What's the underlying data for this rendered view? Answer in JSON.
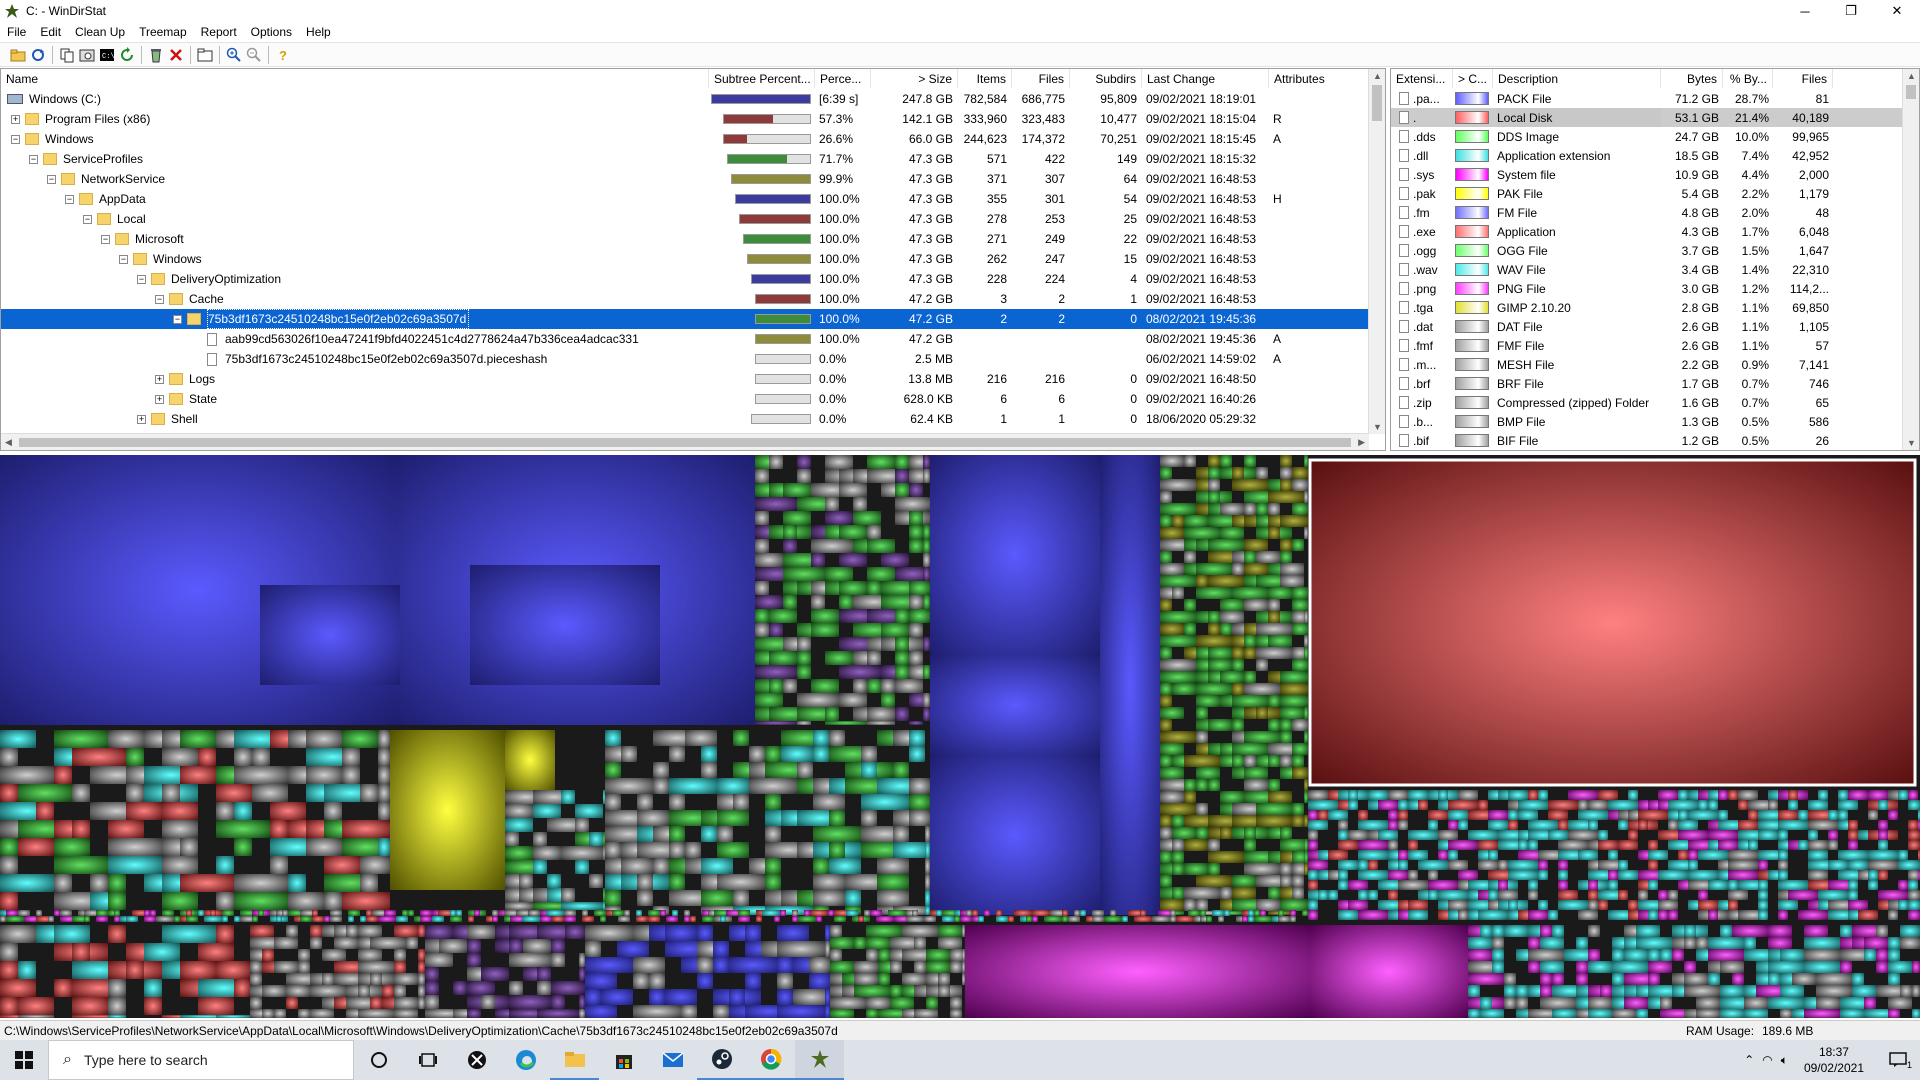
{
  "window": {
    "title": "C: - WinDirStat",
    "minimize": "─",
    "maximize": "❐",
    "close": "✕"
  },
  "menu": [
    "File",
    "Edit",
    "Clean Up",
    "Treemap",
    "Report",
    "Options",
    "Help"
  ],
  "toolbar": {
    "icons": [
      "open-icon",
      "refresh-all-icon",
      "copy-path-icon",
      "explorer-icon",
      "command-prompt-icon",
      "refresh-selected-icon",
      "recycle-icon",
      "delete-icon",
      "properties-icon",
      "zoom-in-icon",
      "zoom-out-icon",
      "help-icon"
    ]
  },
  "tree": {
    "headers": {
      "name": "Name",
      "subtree": "Subtree Percent...",
      "perc": "Perce...",
      "size": "> Size",
      "items": "Items",
      "files": "Files",
      "subdirs": "Subdirs",
      "lastchange": "Last Change",
      "attributes": "Attributes"
    },
    "rows": [
      {
        "indent": 0,
        "pm": "",
        "icon": "drive",
        "name": "Windows (C:)",
        "bar": 1.0,
        "barColor": "#3c3ca0",
        "perc": "[6:39 s]",
        "size": "247.8 GB",
        "items": "782,584",
        "files": "686,775",
        "subdirs": "95,809",
        "last": "09/02/2021  18:19:01",
        "attr": ""
      },
      {
        "indent": 0,
        "pm": "+",
        "icon": "folder",
        "name": "Program Files (x86)",
        "bar": 0.573,
        "barColor": "#8c3a3a",
        "perc": "57.3%",
        "size": "142.1 GB",
        "items": "333,960",
        "files": "323,483",
        "subdirs": "10,477",
        "last": "09/02/2021  18:15:04",
        "attr": "R"
      },
      {
        "indent": 0,
        "pm": "−",
        "icon": "folder",
        "name": "Windows",
        "bar": 0.266,
        "barColor": "#8c3a3a",
        "perc": "26.6%",
        "size": "66.0 GB",
        "items": "244,623",
        "files": "174,372",
        "subdirs": "70,251",
        "last": "09/02/2021  18:15:45",
        "attr": "A"
      },
      {
        "indent": 1,
        "pm": "−",
        "icon": "folder",
        "name": "ServiceProfiles",
        "bar": 0.717,
        "barColor": "#3c8c3c",
        "perc": "71.7%",
        "size": "47.3 GB",
        "items": "571",
        "files": "422",
        "subdirs": "149",
        "last": "09/02/2021  18:15:32",
        "attr": ""
      },
      {
        "indent": 2,
        "pm": "−",
        "icon": "folder",
        "name": "NetworkService",
        "bar": 0.999,
        "barColor": "#8c8c3a",
        "perc": "99.9%",
        "size": "47.3 GB",
        "items": "371",
        "files": "307",
        "subdirs": "64",
        "last": "09/02/2021  16:48:53",
        "attr": ""
      },
      {
        "indent": 3,
        "pm": "−",
        "icon": "folder",
        "name": "AppData",
        "bar": 1.0,
        "barColor": "#3c3ca0",
        "perc": "100.0%",
        "size": "47.3 GB",
        "items": "355",
        "files": "301",
        "subdirs": "54",
        "last": "09/02/2021  16:48:53",
        "attr": "H"
      },
      {
        "indent": 4,
        "pm": "−",
        "icon": "folder",
        "name": "Local",
        "bar": 1.0,
        "barColor": "#8c3a3a",
        "perc": "100.0%",
        "size": "47.3 GB",
        "items": "278",
        "files": "253",
        "subdirs": "25",
        "last": "09/02/2021  16:48:53",
        "attr": ""
      },
      {
        "indent": 5,
        "pm": "−",
        "icon": "folder",
        "name": "Microsoft",
        "bar": 1.0,
        "barColor": "#3c8c3c",
        "perc": "100.0%",
        "size": "47.3 GB",
        "items": "271",
        "files": "249",
        "subdirs": "22",
        "last": "09/02/2021  16:48:53",
        "attr": ""
      },
      {
        "indent": 6,
        "pm": "−",
        "icon": "folder",
        "name": "Windows",
        "bar": 1.0,
        "barColor": "#8c8c3a",
        "perc": "100.0%",
        "size": "47.3 GB",
        "items": "262",
        "files": "247",
        "subdirs": "15",
        "last": "09/02/2021  16:48:53",
        "attr": ""
      },
      {
        "indent": 7,
        "pm": "−",
        "icon": "folder",
        "name": "DeliveryOptimization",
        "bar": 1.0,
        "barColor": "#3c3ca0",
        "perc": "100.0%",
        "size": "47.3 GB",
        "items": "228",
        "files": "224",
        "subdirs": "4",
        "last": "09/02/2021  16:48:53",
        "attr": ""
      },
      {
        "indent": 8,
        "pm": "−",
        "icon": "folder",
        "name": "Cache",
        "bar": 1.0,
        "barColor": "#8c3a3a",
        "perc": "100.0%",
        "size": "47.2 GB",
        "items": "3",
        "files": "2",
        "subdirs": "1",
        "last": "09/02/2021  16:48:53",
        "attr": ""
      },
      {
        "indent": 9,
        "pm": "−",
        "icon": "folder",
        "name": "75b3df1673c24510248bc15e0f2eb02c69a3507d",
        "bar": 1.0,
        "barColor": "#3c8c3c",
        "perc": "100.0%",
        "size": "47.2 GB",
        "items": "2",
        "files": "2",
        "subdirs": "0",
        "last": "08/02/2021  19:45:36",
        "attr": "",
        "selected": true
      },
      {
        "indent": 10,
        "pm": "",
        "icon": "file",
        "name": "aab99cd563026f10ea47241f9bfd4022451c4d2778624a47b336cea4adcac331",
        "bar": 1.0,
        "barColor": "#8c8c3a",
        "perc": "100.0%",
        "size": "47.2 GB",
        "items": "",
        "files": "",
        "subdirs": "",
        "last": "08/02/2021  19:45:36",
        "attr": "A"
      },
      {
        "indent": 10,
        "pm": "",
        "icon": "file",
        "name": "75b3df1673c24510248bc15e0f2eb02c69a3507d.pieceshash",
        "bar": 0.0,
        "barColor": "#8c8c3a",
        "perc": "0.0%",
        "size": "2.5 MB",
        "items": "",
        "files": "",
        "subdirs": "",
        "last": "06/02/2021  14:59:02",
        "attr": "A"
      },
      {
        "indent": 8,
        "pm": "+",
        "icon": "folder",
        "name": "Logs",
        "bar": 0.0,
        "barColor": "#3c3ca0",
        "perc": "0.0%",
        "size": "13.8 MB",
        "items": "216",
        "files": "216",
        "subdirs": "0",
        "last": "09/02/2021  16:48:50",
        "attr": ""
      },
      {
        "indent": 8,
        "pm": "+",
        "icon": "folder",
        "name": "State",
        "bar": 0.0,
        "barColor": "#3c3ca0",
        "perc": "0.0%",
        "size": "628.0 KB",
        "items": "6",
        "files": "6",
        "subdirs": "0",
        "last": "09/02/2021  16:40:26",
        "attr": ""
      },
      {
        "indent": 7,
        "pm": "+",
        "icon": "folder",
        "name": "Shell",
        "bar": 0.0,
        "barColor": "#3c3ca0",
        "perc": "0.0%",
        "size": "62.4 KB",
        "items": "1",
        "files": "1",
        "subdirs": "0",
        "last": "18/06/2020  05:29:32",
        "attr": ""
      }
    ]
  },
  "extensions": {
    "headers": {
      "ext": "Extensi...",
      "color": "> C...",
      "desc": "Description",
      "bytes": "Bytes",
      "pct": "% By...",
      "files": "Files"
    },
    "rows": [
      {
        "ext": ".pa...",
        "color": "#6060ff",
        "desc": "PACK File",
        "bytes": "71.2 GB",
        "pct": "28.7%",
        "files": "81"
      },
      {
        "ext": ".",
        "color": "#ff6060",
        "desc": "Local Disk",
        "bytes": "53.1 GB",
        "pct": "21.4%",
        "files": "40,189",
        "selected": true
      },
      {
        "ext": ".dds",
        "color": "#60ff60",
        "desc": "DDS Image",
        "bytes": "24.7 GB",
        "pct": "10.0%",
        "files": "99,965"
      },
      {
        "ext": ".dll",
        "color": "#40e0e0",
        "desc": "Application extension",
        "bytes": "18.5 GB",
        "pct": "7.4%",
        "files": "42,952"
      },
      {
        "ext": ".sys",
        "color": "#ff00ff",
        "desc": "System file",
        "bytes": "10.9 GB",
        "pct": "4.4%",
        "files": "2,000"
      },
      {
        "ext": ".pak",
        "color": "#ffff00",
        "desc": "PAK File",
        "bytes": "5.4 GB",
        "pct": "2.2%",
        "files": "1,179"
      },
      {
        "ext": ".fm",
        "color": "#7070ff",
        "desc": "FM File",
        "bytes": "4.8 GB",
        "pct": "2.0%",
        "files": "48"
      },
      {
        "ext": ".exe",
        "color": "#ff7070",
        "desc": "Application",
        "bytes": "4.3 GB",
        "pct": "1.7%",
        "files": "6,048"
      },
      {
        "ext": ".ogg",
        "color": "#70ff70",
        "desc": "OGG File",
        "bytes": "3.7 GB",
        "pct": "1.5%",
        "files": "1,647"
      },
      {
        "ext": ".wav",
        "color": "#50e8e8",
        "desc": "WAV File",
        "bytes": "3.4 GB",
        "pct": "1.4%",
        "files": "22,310"
      },
      {
        "ext": ".png",
        "color": "#ff40ff",
        "desc": "PNG File",
        "bytes": "3.0 GB",
        "pct": "1.2%",
        "files": "114,2..."
      },
      {
        "ext": ".tga",
        "color": "#e0e030",
        "desc": "GIMP 2.10.20",
        "bytes": "2.8 GB",
        "pct": "1.1%",
        "files": "69,850"
      },
      {
        "ext": ".dat",
        "color": "#a0a0a0",
        "desc": "DAT File",
        "bytes": "2.6 GB",
        "pct": "1.1%",
        "files": "1,105"
      },
      {
        "ext": ".fmf",
        "color": "#a0a0a0",
        "desc": "FMF File",
        "bytes": "2.6 GB",
        "pct": "1.1%",
        "files": "57"
      },
      {
        "ext": ".m...",
        "color": "#a0a0a0",
        "desc": "MESH File",
        "bytes": "2.2 GB",
        "pct": "0.9%",
        "files": "7,141"
      },
      {
        "ext": ".brf",
        "color": "#a0a0a0",
        "desc": "BRF File",
        "bytes": "1.7 GB",
        "pct": "0.7%",
        "files": "746"
      },
      {
        "ext": ".zip",
        "color": "#a0a0a0",
        "desc": "Compressed (zipped) Folder",
        "bytes": "1.6 GB",
        "pct": "0.7%",
        "files": "65"
      },
      {
        "ext": ".b...",
        "color": "#a0a0a0",
        "desc": "BMP File",
        "bytes": "1.3 GB",
        "pct": "0.5%",
        "files": "586"
      },
      {
        "ext": ".bif",
        "color": "#a0a0a0",
        "desc": "BIF File",
        "bytes": "1.2 GB",
        "pct": "0.5%",
        "files": "26"
      }
    ]
  },
  "statusbar": {
    "path": "C:\\Windows\\ServiceProfiles\\NetworkService\\AppData\\Local\\Microsoft\\Windows\\DeliveryOptimization\\Cache\\75b3df1673c24510248bc15e0f2eb02c69a3507d",
    "ram_label": "RAM Usage:",
    "ram_value": "189.6 MB"
  },
  "taskbar": {
    "search_placeholder": "Type here to search",
    "time": "18:37",
    "date": "09/02/2021",
    "notification_count": "1",
    "icons": [
      "cortana-icon",
      "task-view-icon",
      "xbox-icon",
      "edge-icon",
      "file-explorer-icon",
      "store-icon",
      "mail-icon",
      "steam-icon",
      "chrome-icon",
      "windirstat-icon"
    ]
  }
}
